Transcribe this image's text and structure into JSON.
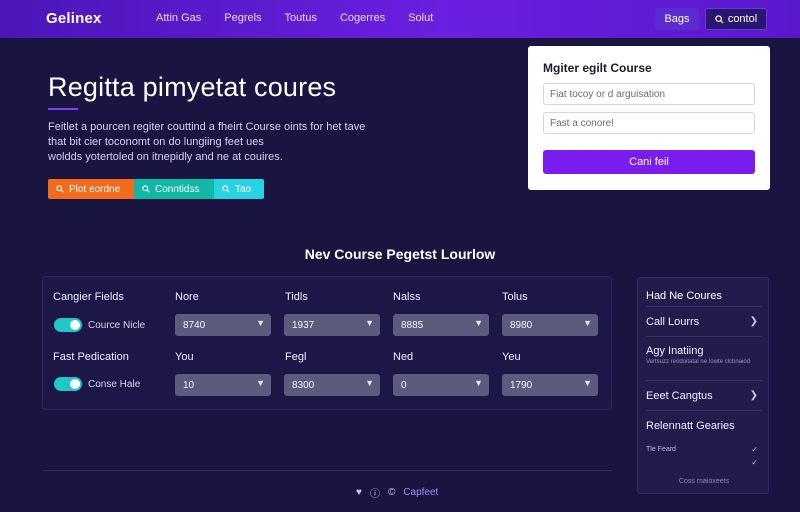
{
  "brand": {
    "logo": "Gelinex"
  },
  "nav": {
    "items": [
      "Attin Gas",
      "Pegrels",
      "Toutus",
      "Cogerres",
      "Solut"
    ]
  },
  "top_buttons": {
    "primary": "Bags",
    "secondary": "contol"
  },
  "hero": {
    "title": "Regitta pimyetat coures",
    "desc_lines": [
      "Feitlet a pourcen regiter couttind a fheirt Course oints for het tave",
      "that bit cier toconomt on do lungiing feet ues",
      "woldds yotertoled on itnepidly and ne at couires."
    ],
    "tags": [
      "Plot eordne",
      "Conntidss",
      "Tao"
    ]
  },
  "register_card": {
    "title": "Mgiter egilt Course",
    "input1_placeholder": "Fiat tocoy or d arguisation",
    "input2_placeholder": "Fast a conore!",
    "button": "Cani feil"
  },
  "section": {
    "title": "Nev Course Pegetst Lourlow"
  },
  "form": {
    "row1": {
      "field_label": "Cangier Fields",
      "toggle_label": "Cource Nicle",
      "headers": [
        "Nore",
        "Tidls",
        "Nalss",
        "Tolus"
      ],
      "values": [
        "8740",
        "1937",
        "8885",
        "8980"
      ]
    },
    "row2": {
      "field_label": "Fast Pedication",
      "toggle_label": "Conse Hale",
      "headers": [
        "You",
        "Fegl",
        "Ned",
        "Yeu"
      ],
      "values": [
        "10",
        "8300",
        "0",
        "1790"
      ]
    }
  },
  "sidebar": {
    "heading": "Had Ne Coures",
    "items": [
      {
        "label": "Call Lourrs",
        "sub": ""
      },
      {
        "label": "Agy Inatiing",
        "sub": "Vertsuzz reodoitatal ne Iowte clcbnaiod"
      },
      {
        "label": "Eeet Cangtus",
        "sub": ""
      },
      {
        "label": "Relennatt Gearies",
        "sub": ""
      }
    ],
    "small_item": "Tle Feard",
    "footer": "Coss rnaioxeets"
  },
  "footer": {
    "link": "Capfeet"
  },
  "colors": {
    "bg": "#1a1440",
    "nav": "#6b1fe0",
    "accent": "#7a1cf0",
    "orange": "#f26b1d",
    "teal": "#0fb8a4",
    "cyan": "#27d3e0",
    "toggle": "#1fc9c9"
  },
  "icons": {
    "search": "search-icon",
    "chevron": "chevron-down-icon",
    "arrow": "chevron-right-icon",
    "heart": "heart-icon",
    "info": "info-icon",
    "copyright": "copyright-icon"
  }
}
